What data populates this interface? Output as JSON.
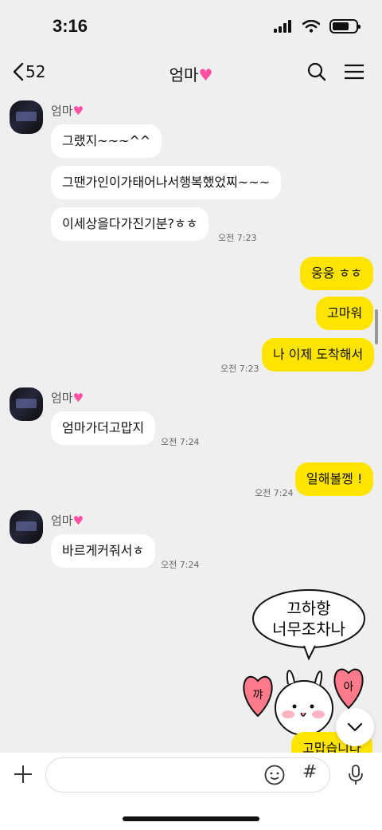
{
  "status": {
    "time": "3:16"
  },
  "nav": {
    "back_count": "52",
    "title": "엄마"
  },
  "messages": [
    {
      "sender": "엄마"
    },
    {
      "text": "그랬지~~~^^"
    },
    {
      "text": "그땐가인이가태어나서행복했었찌~~~"
    },
    {
      "text": "이세상을다가진기분?ㅎㅎ",
      "time": "오전 7:23"
    },
    {
      "text": "웅웅 ㅎㅎ"
    },
    {
      "text": "고마워"
    },
    {
      "text": "나 이제 도착해서",
      "time": "오전 7:23"
    },
    {
      "sender": "엄마"
    },
    {
      "text": "엄마가더고맙지",
      "time": "오전 7:24"
    },
    {
      "text": "일해볼껭 !",
      "time": "오전 7:24"
    },
    {
      "sender": "엄마"
    },
    {
      "text": "바르게커줘서ㅎ",
      "time": "오전 7:24"
    },
    {
      "text": "고맙습니다"
    }
  ],
  "sticker": {
    "line1": "끄하항",
    "line2": "너무조차나",
    "left": "꺄",
    "right": "아"
  },
  "composer": {
    "placeholder": ""
  },
  "colors": {
    "my_bubble": "#ffe400",
    "their_bubble": "#ffffff",
    "background": "#efefef",
    "heart": "#ff4fa3"
  },
  "icons": [
    "signal-icon",
    "wifi-icon",
    "battery-icon",
    "back-chevron-icon",
    "heart-icon",
    "search-icon",
    "menu-icon",
    "chevron-down-icon",
    "plus-icon",
    "emoji-icon",
    "hash-icon",
    "mic-icon"
  ]
}
